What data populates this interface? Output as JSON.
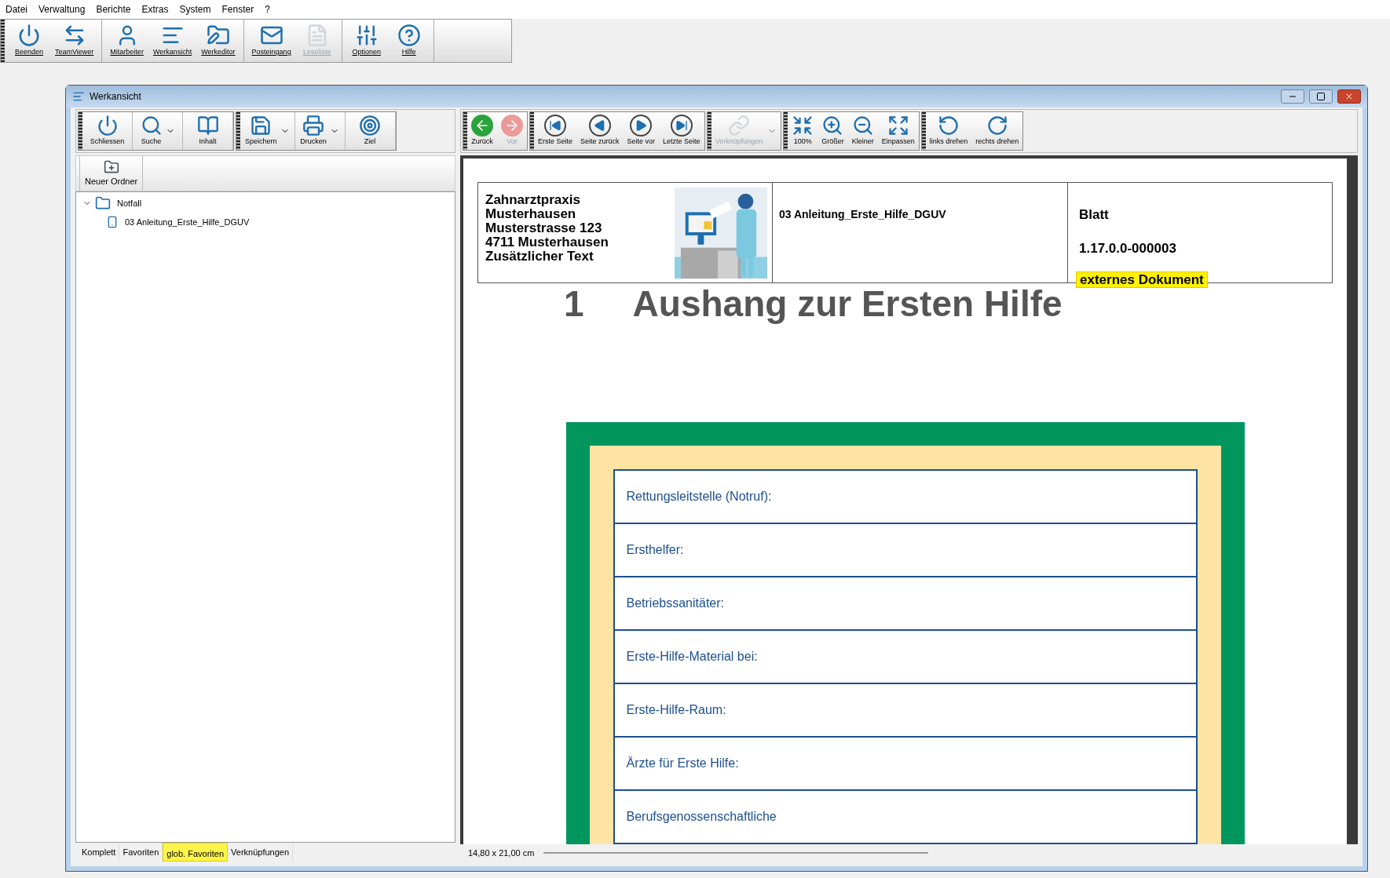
{
  "menu": [
    "Datei",
    "Verwaltung",
    "Berichte",
    "Extras",
    "System",
    "Fenster",
    "?"
  ],
  "main_toolbar": [
    [
      {
        "label": "Beenden",
        "disabled": false
      },
      {
        "label": "TeamViewer",
        "disabled": false
      }
    ],
    [
      {
        "label": "Mitarbeiter",
        "disabled": false
      },
      {
        "label": "Werkansicht",
        "disabled": false
      },
      {
        "label": "Werkeditor",
        "disabled": false
      }
    ],
    [
      {
        "label": "Posteingang",
        "disabled": false
      },
      {
        "label": "Leseliste",
        "disabled": true
      }
    ],
    [
      {
        "label": "Optionen",
        "disabled": false
      },
      {
        "label": "Hilfe",
        "disabled": false
      }
    ]
  ],
  "window": {
    "title": "Werkansicht"
  },
  "left_toolbar": [
    [
      {
        "label": "Schliessen",
        "dropdown": false
      },
      {
        "label": "Suche",
        "dropdown": true
      },
      {
        "label": "Inhalt",
        "dropdown": false
      }
    ],
    [
      {
        "label": "Speichern",
        "dropdown": true
      },
      {
        "label": "Drucken",
        "dropdown": true
      },
      {
        "label": "Ziel",
        "dropdown": false
      }
    ]
  ],
  "new_folder": {
    "label": "Neuer Ordner"
  },
  "tree": [
    {
      "label": "Notfall",
      "expanded": true,
      "children": [
        {
          "label": "03 Anleitung_Erste_Hilfe_DGUV"
        }
      ]
    }
  ],
  "tabs": [
    {
      "label": "Komplett",
      "selected": false
    },
    {
      "label": "Favoriten",
      "selected": false
    },
    {
      "label": "glob. Favoriten",
      "selected": true
    },
    {
      "label": "Verknüpfungen",
      "selected": false
    }
  ],
  "viewer_toolbar": [
    [
      {
        "label": "Zurück",
        "disabled": false,
        "dropdown": false
      },
      {
        "label": "Vor",
        "disabled": true,
        "dropdown": false
      }
    ],
    [
      {
        "label": "Erste Seite",
        "disabled": false,
        "dropdown": false
      },
      {
        "label": "Seite zurück",
        "disabled": false,
        "dropdown": false
      },
      {
        "label": "Seite vor",
        "disabled": false,
        "dropdown": false
      },
      {
        "label": "Letzte Seite",
        "disabled": false,
        "dropdown": false
      }
    ],
    [
      {
        "label": "Verknüpfungen",
        "disabled": true,
        "dropdown": true
      }
    ],
    [
      {
        "label": "100%",
        "disabled": false,
        "dropdown": false
      },
      {
        "label": "Größer",
        "disabled": false,
        "dropdown": false
      },
      {
        "label": "Kleiner",
        "disabled": false,
        "dropdown": false
      },
      {
        "label": "Einpassen",
        "disabled": false,
        "dropdown": false
      }
    ],
    [
      {
        "label": "links drehen",
        "disabled": false,
        "dropdown": false
      },
      {
        "label": "rechts drehen",
        "disabled": false,
        "dropdown": false
      }
    ]
  ],
  "document": {
    "address": [
      "Zahnarztpraxis",
      "Musterhausen",
      "Musterstrasse 123",
      "4711 Musterhausen",
      "Zusätzlicher Text"
    ],
    "doc_name": "03 Anleitung_Erste_Hilfe_DGUV",
    "sheet_label": "Blatt",
    "version": "1.17.0.0-000003",
    "badge": "externes Dokument",
    "heading_number": "1",
    "heading": "Aushang zur Ersten Hilfe",
    "poster_rows": [
      "Rettungsleitstelle (Notruf):",
      "Ersthelfer:",
      "Betriebssanitäter:",
      "Erste-Hilfe-Material bei:",
      "Erste-Hilfe-Raum:",
      "Ärzte für Erste Hilfe:",
      "Berufsgenossenschaftliche"
    ]
  },
  "status_bar": {
    "page_size": "14,80 x 21,00 cm"
  }
}
